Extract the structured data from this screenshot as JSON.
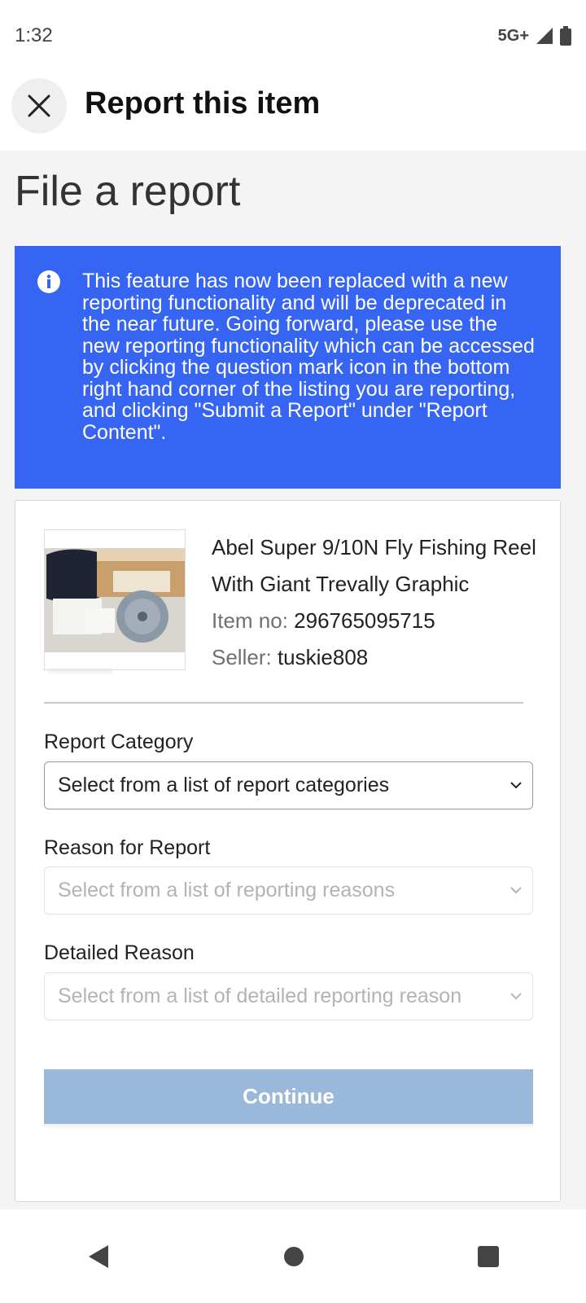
{
  "status_bar": {
    "time": "1:32",
    "network": "5G+",
    "icons": [
      "signal-icon",
      "battery-icon"
    ]
  },
  "app_bar": {
    "close_icon": "close-icon",
    "title": "Report this item"
  },
  "page": {
    "heading": "File a report"
  },
  "info_banner": {
    "icon": "info-icon",
    "text": "This feature has now been replaced with a new reporting functionality and will be deprecated in the near future. Going forward, please use the new reporting functionality which can be accessed by clicking the question mark icon in the bottom right hand corner of the listing you are reporting, and clicking \"Submit a Report\" under \"Report Content\".",
    "color": "#3665f3"
  },
  "item": {
    "title": "Abel Super 9/10N Fly Fishing Reel With Giant Trevally Graphic",
    "item_no_label": "Item no:",
    "item_no": "296765095715",
    "seller_label": "Seller:",
    "seller": "tuskie808"
  },
  "form": {
    "category_label": "Report Category",
    "category_placeholder": "Select from a list of report categories",
    "reason_label": "Reason for Report",
    "reason_placeholder": "Select from a list of reporting reasons",
    "detailed_label": "Detailed Reason",
    "detailed_placeholder": "Select from a list of detailed reporting reason",
    "continue_label": "Continue"
  },
  "nav_bar": {
    "icons": [
      "back-icon",
      "home-icon",
      "recents-icon"
    ]
  }
}
